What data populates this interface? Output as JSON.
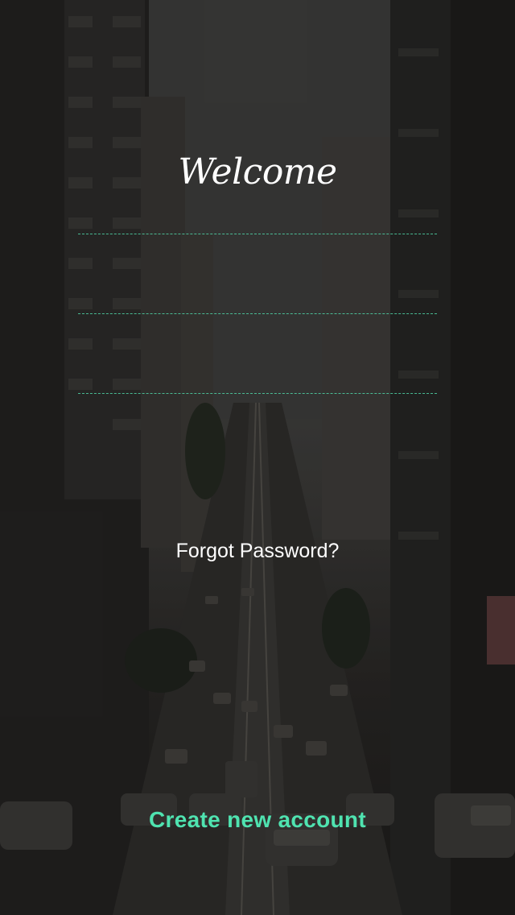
{
  "screen": {
    "title": "Welcome",
    "accent_color": "#4fe3b0",
    "background": "city-street-photo"
  },
  "form": {
    "fields": [
      {
        "value": "",
        "placeholder": ""
      },
      {
        "value": "",
        "placeholder": ""
      },
      {
        "value": "",
        "placeholder": ""
      }
    ]
  },
  "links": {
    "forgot_password": "Forgot Password?",
    "create_account": "Create new account"
  }
}
